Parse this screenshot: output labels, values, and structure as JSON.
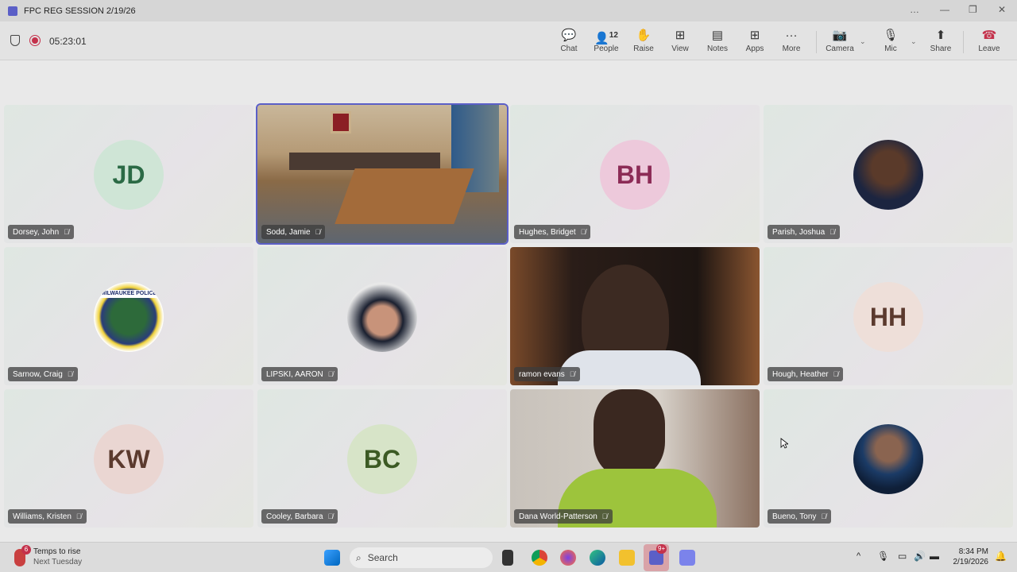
{
  "window": {
    "title": "FPC REG SESSION 2/19/26",
    "controls": [
      "…",
      "—",
      "❐",
      "✕"
    ]
  },
  "meeting": {
    "timer": "05:23:01",
    "people_count": "12"
  },
  "toolbar": [
    {
      "id": "chat",
      "label": "Chat",
      "icon": "💬"
    },
    {
      "id": "people",
      "label": "People",
      "icon": "👤"
    },
    {
      "id": "raise",
      "label": "Raise",
      "icon": "✋"
    },
    {
      "id": "view",
      "label": "View",
      "icon": "⊞"
    },
    {
      "id": "notes",
      "label": "Notes",
      "icon": "▤"
    },
    {
      "id": "apps",
      "label": "Apps",
      "icon": "⊞"
    },
    {
      "id": "more",
      "label": "More",
      "icon": "···"
    },
    {
      "id": "camera",
      "label": "Camera",
      "icon": "📷"
    },
    {
      "id": "mic",
      "label": "Mic",
      "icon": "🎙"
    },
    {
      "id": "share",
      "label": "Share",
      "icon": "⬆"
    },
    {
      "id": "leave",
      "label": "Leave",
      "icon": "☎"
    }
  ],
  "participants": [
    {
      "name": "Dorsey, John",
      "initials": "JD",
      "type": "initials",
      "bg": "#cfe5d6",
      "fg": "#2b6a45"
    },
    {
      "name": "Sodd, Jamie",
      "type": "video-room"
    },
    {
      "name": "Hughes, Bridget",
      "initials": "BH",
      "type": "initials",
      "bg": "#edc9db",
      "fg": "#8c2b56"
    },
    {
      "name": "Parish, Joshua",
      "type": "photo-fire"
    },
    {
      "name": "Sarnow, Craig",
      "type": "photo-badge",
      "badge_text": "MILWAUKEE POLICE"
    },
    {
      "name": "LIPSKI, AARON",
      "type": "photo-captain"
    },
    {
      "name": "ramon evans",
      "type": "video-person"
    },
    {
      "name": "Hough, Heather",
      "initials": "HH",
      "type": "initials",
      "bg": "#eedfd9",
      "fg": "#5b3a2e"
    },
    {
      "name": "Williams, Kristen",
      "initials": "KW",
      "type": "initials",
      "bg": "#ead6d2",
      "fg": "#5b3a2e"
    },
    {
      "name": "Cooley, Barbara",
      "initials": "BC",
      "type": "initials",
      "bg": "#d7e4c8",
      "fg": "#3c5a24"
    },
    {
      "name": "Dana World-Patterson",
      "type": "video-dana"
    },
    {
      "name": "Bueno, Tony",
      "type": "photo-suit"
    }
  ],
  "taskbar": {
    "weather_title": "Temps to rise",
    "weather_sub": "Next Tuesday",
    "weather_badge": "6",
    "search_placeholder": "Search",
    "teams_badge": "9+",
    "time": "8:34 PM",
    "date": "2/19/2026"
  }
}
